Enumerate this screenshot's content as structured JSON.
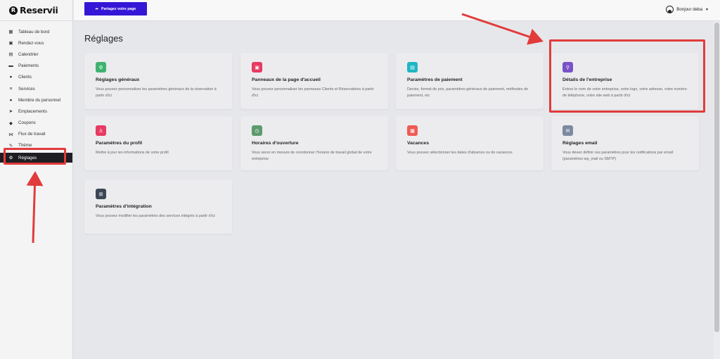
{
  "brand": {
    "name": "Reservii",
    "mark": "R"
  },
  "sidebar": {
    "items": [
      {
        "label": "Tableau de bord",
        "icon": "dashboard-icon",
        "glyph": "▦",
        "active": false
      },
      {
        "label": "Rendez-vous",
        "icon": "calendar-check-icon",
        "glyph": "▣",
        "active": false
      },
      {
        "label": "Calendrier",
        "icon": "calendar-icon",
        "glyph": "▤",
        "active": false
      },
      {
        "label": "Paiements",
        "icon": "wallet-icon",
        "glyph": "▬",
        "active": false
      },
      {
        "label": "Clients",
        "icon": "users-icon",
        "glyph": "●",
        "active": false
      },
      {
        "label": "Services",
        "icon": "list-icon",
        "glyph": "≡",
        "active": false
      },
      {
        "label": "Membre du personnel",
        "icon": "user-icon",
        "glyph": "●",
        "active": false
      },
      {
        "label": "Emplacements",
        "icon": "location-arrow-icon",
        "glyph": "➤",
        "active": false
      },
      {
        "label": "Coupons",
        "icon": "tag-icon",
        "glyph": "◆",
        "active": false
      },
      {
        "label": "Flux de travail",
        "icon": "workflow-icon",
        "glyph": "⋈",
        "active": false
      },
      {
        "label": "Thème",
        "icon": "brush-icon",
        "glyph": "✎",
        "active": false
      },
      {
        "label": "Réglages",
        "icon": "gear-icon",
        "glyph": "⚙",
        "active": true
      }
    ]
  },
  "topbar": {
    "share_label": "Partagez votre page",
    "share_icon": "share-icon",
    "user_label": "Bonjour deba",
    "caret": "▼"
  },
  "main": {
    "title": "Réglages",
    "cards": [
      {
        "title": "Réglages généraux",
        "desc": "Vous pouvez personnaliser les paramètres généraux de la réservation à partir d'ici",
        "icon": "gear-icon",
        "glyph": "⚙",
        "color": "#3fb370"
      },
      {
        "title": "Panneaux de la page d'accueil",
        "desc": "Vous pouvez personnaliser les panneaux Clients et Réservations à partir d'ici",
        "icon": "panel-icon",
        "glyph": "▣",
        "color": "#e73a62"
      },
      {
        "title": "Paramètres de paiement",
        "desc": "Devise, format de prix, paramètres généraux de paiement, méthodes de paiement, etc",
        "icon": "payment-icon",
        "glyph": "▤",
        "color": "#1fb6c4"
      },
      {
        "title": "Détails de l'entreprise",
        "desc": "Entrez le nom de votre entreprise, votre logo, votre adresse, votre numéro de téléphone, votre site web à partir d'ici",
        "icon": "business-icon",
        "glyph": "⚲",
        "color": "#7a52c8"
      },
      {
        "title": "Paramètres du profil",
        "desc": "Mettre à jour les informations de votre profil",
        "icon": "profile-icon",
        "glyph": "♙",
        "color": "#e73a62"
      },
      {
        "title": "Horaires d'ouverture",
        "desc": "Vous serez en mesure de coordonner l'horaire de travail global de votre entreprise",
        "icon": "clock-icon",
        "glyph": "◷",
        "color": "#5d9a6e"
      },
      {
        "title": "Vacances",
        "desc": "Vous pouvez sélectionner les dates d'absence ou de vacances",
        "icon": "vacation-calendar-icon",
        "glyph": "▦",
        "color": "#ef5a54"
      },
      {
        "title": "Réglages email",
        "desc": "Vous devez définir ces paramètres pour les notifications par email (paramètres wp_mail ou SMTP)",
        "icon": "email-icon",
        "glyph": "✉",
        "color": "#7b8aa2"
      },
      {
        "title": "Paramètres d'intégration",
        "desc": "Vous pouvez modifier les paramètres des services intégrés à partir d'ici",
        "icon": "integration-icon",
        "glyph": "⊞",
        "color": "#3b4656"
      }
    ]
  },
  "annotations": {
    "color": "#e23b3b"
  }
}
